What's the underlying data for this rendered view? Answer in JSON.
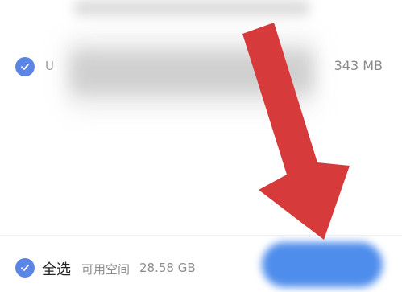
{
  "list_item": {
    "name_partial": "U",
    "size": "343 MB",
    "checked": true
  },
  "footer": {
    "select_all_label": "全选",
    "available_space_label": "可用空间",
    "available_space_value": "28.58 GB"
  },
  "colors": {
    "accent": "#5b86e5",
    "button": "#4f8dec",
    "arrow": "#d63a3a"
  }
}
